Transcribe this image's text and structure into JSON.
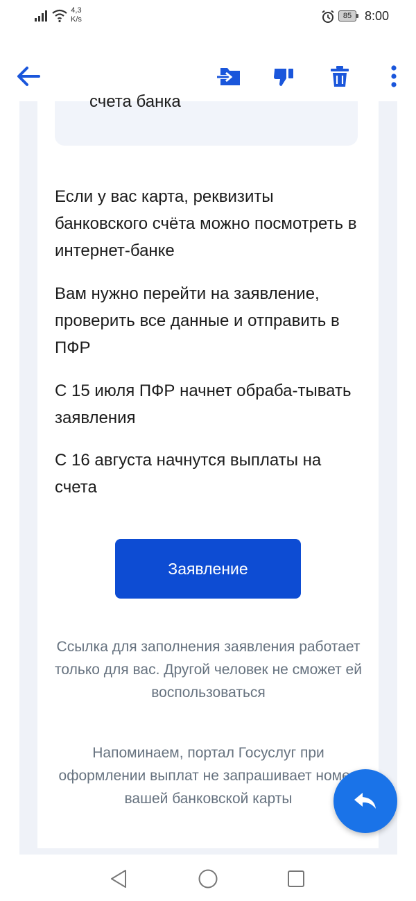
{
  "status_bar": {
    "speed_value": "4,3",
    "speed_unit": "K/s",
    "battery": "85",
    "time": "8:00"
  },
  "toolbar": {
    "icons": [
      "back-arrow-icon",
      "move-to-folder-icon",
      "thumbs-down-icon",
      "trash-icon",
      "more-vertical-icon"
    ]
  },
  "message": {
    "info_box_text": "счета банка",
    "paragraphs": [
      "Если у вас карта, реквизиты банковского счёта можно посмотреть в интернет-банке",
      "Вам нужно перейти на заявление, проверить все данные и отправить в ПФР",
      "С 15 июля ПФР начнет обраба-тывать заявления",
      "С 16 августа начнутся выплаты на счета"
    ],
    "button_label": "Заявление",
    "note_1": "Ссылка для заполнения заявления работает только для вас. Другой человек не сможет ей воспользоваться",
    "note_2": "Напоминаем, портал Госуслуг при оформлении выплат не запрашивает номер вашей банковской карты"
  },
  "colors": {
    "accent": "#0d4cd3",
    "icon_blue": "#1a56db",
    "fab": "#1a73e8",
    "background": "#eff2f8"
  }
}
